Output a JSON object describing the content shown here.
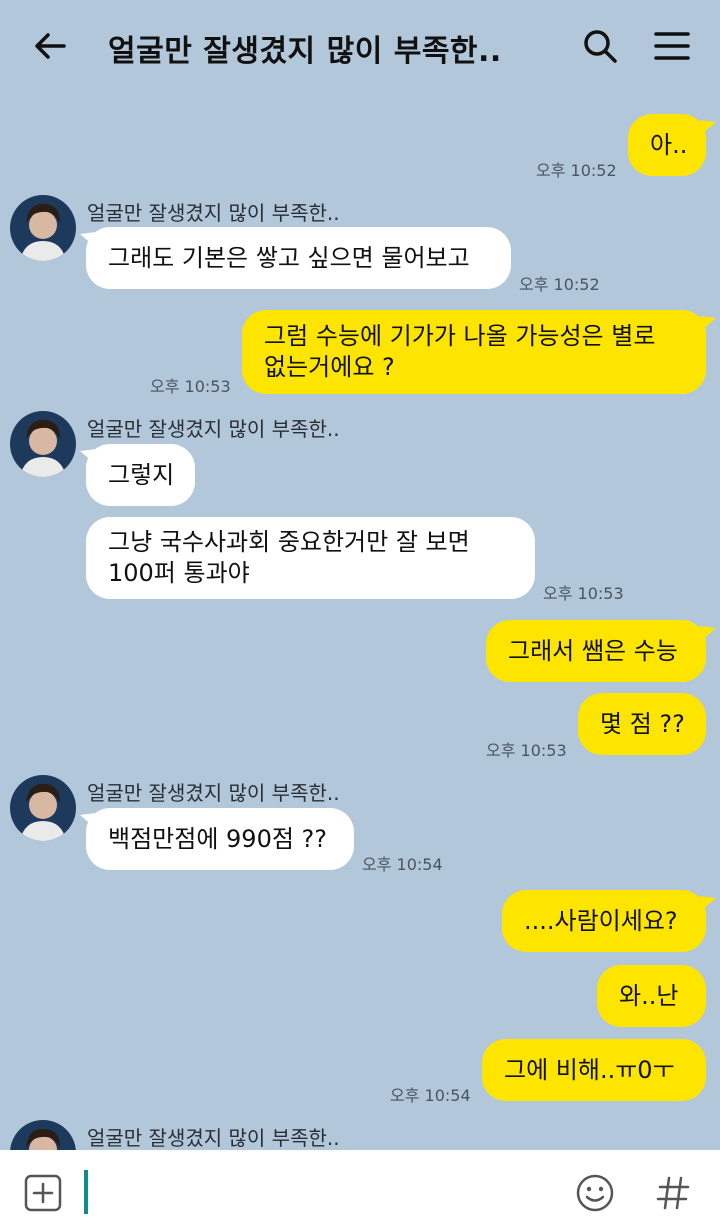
{
  "header": {
    "title": "얼굴만 잘생겼지 많이 부족한..",
    "back_icon": "arrow-left-icon",
    "search_icon": "search-icon",
    "menu_icon": "hamburger-menu-icon"
  },
  "colors": {
    "background": "#b2c7d9",
    "my_bubble": "#fee500",
    "their_bubble": "#ffffff",
    "caret": "#0e8d8a"
  },
  "messages": [
    {
      "from": "me",
      "text": "아..",
      "time": "오후 10:52"
    },
    {
      "from": "them",
      "sender": "얼굴만 잘생겼지 많이 부족한..",
      "text": "그래도 기본은 쌓고 싶으면 물어보고",
      "time": "오후 10:52"
    },
    {
      "from": "me",
      "text": "그럼 수능에 기가가 나올 가능성은 별로 없는거에요 ?",
      "time": "오후 10:53"
    },
    {
      "from": "them",
      "sender": "얼굴만 잘생겼지 많이 부족한..",
      "text": "그렇지"
    },
    {
      "from": "them",
      "text": "그냥 국수사과회 중요한거만 잘 보면 100퍼 통과야",
      "time": "오후 10:53"
    },
    {
      "from": "me",
      "text": "그래서 쌤은 수능"
    },
    {
      "from": "me",
      "text": "몇 점 ??",
      "time": "오후 10:53"
    },
    {
      "from": "them",
      "sender": "얼굴만 잘생겼지 많이 부족한..",
      "text": "백점만점에 990점 ??",
      "time": "오후 10:54"
    },
    {
      "from": "me",
      "text": "....사람이세요?"
    },
    {
      "from": "me",
      "text": "와..난"
    },
    {
      "from": "me",
      "text": "그에 비해..ㅠ0ㅜ",
      "time": "오후 10:54"
    },
    {
      "from": "them",
      "sender": "얼굴만 잘생겼지 많이 부족한.."
    }
  ],
  "input": {
    "value": "",
    "plus_icon": "plus-square-icon",
    "emoji_icon": "smiley-icon",
    "hash_icon": "hashtag-icon"
  }
}
